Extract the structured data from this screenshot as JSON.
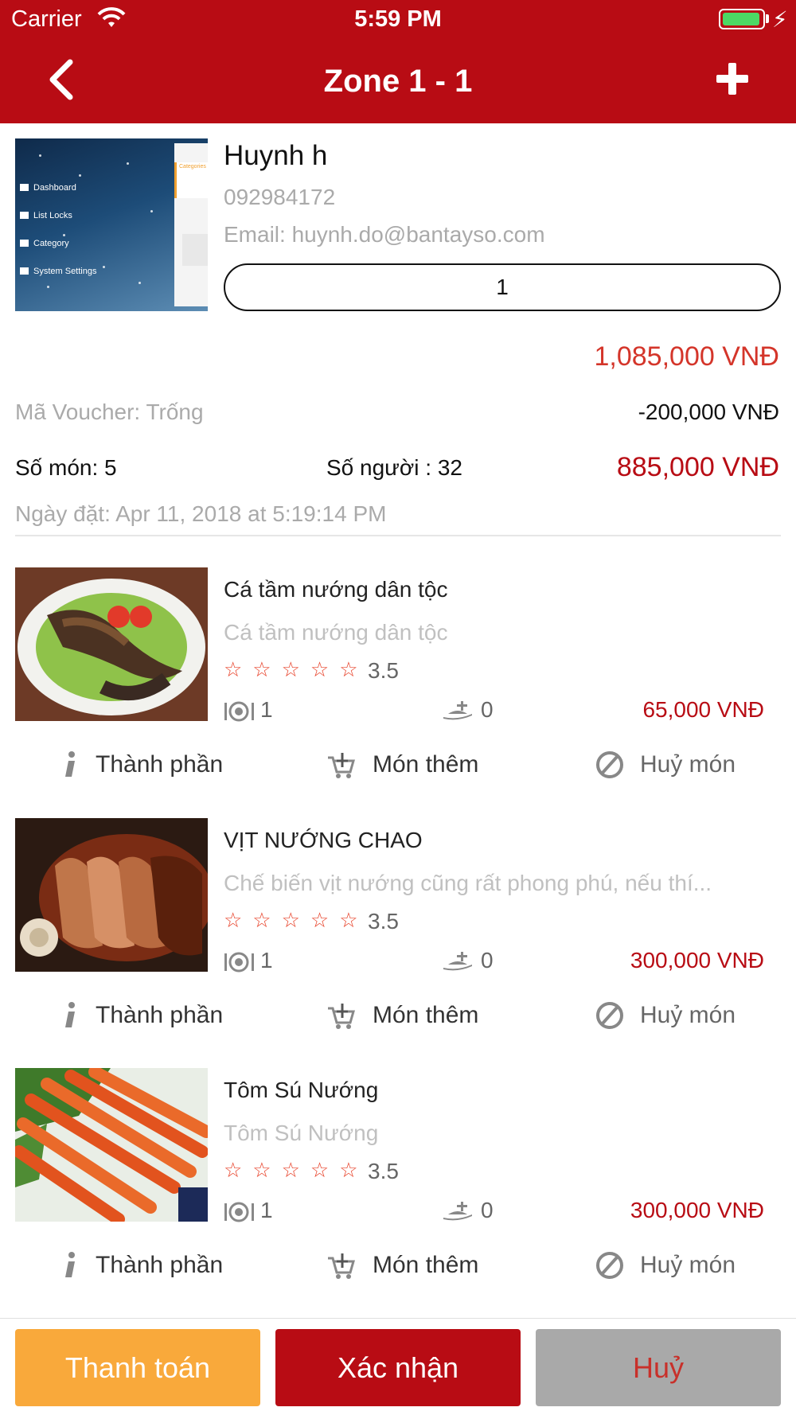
{
  "status_bar": {
    "carrier": "Carrier",
    "time": "5:59 PM"
  },
  "nav": {
    "title": "Zone 1 - 1",
    "back_icon": "chevron-left-icon",
    "add_icon": "plus-icon"
  },
  "customer": {
    "name": "Huynh h",
    "phone": "092984172",
    "email": "Email: huynh.do@bantayso.com",
    "table_number": "1",
    "thumbnail_menu": [
      "Dashboard",
      "List Locks",
      "Category",
      "System Settings"
    ],
    "thumbnail_panel_title": "Categories"
  },
  "summary": {
    "subtotal": "1,085,000 VNĐ",
    "voucher_label": "Mã Voucher: Trống",
    "voucher_amount": "-200,000 VNĐ",
    "dish_count": "Số món: 5",
    "people_count": "Số người : 32",
    "total": "885,000 VNĐ",
    "order_date": "Ngày đặt: Apr 11, 2018 at 5:19:14 PM"
  },
  "dishes": [
    {
      "name": "Cá tầm nướng dân tộc",
      "description": "Cá tầm nướng dân tộc",
      "stars": "☆☆☆☆☆",
      "rating": "3.5",
      "quantity": "1",
      "extras": "0",
      "price": "65,000 VNĐ"
    },
    {
      "name": "VỊT NƯỚNG CHAO",
      "description": "Chế biến vịt nướng cũng rất phong phú, nếu thí...",
      "stars": "☆☆☆☆☆",
      "rating": "3.5",
      "quantity": "1",
      "extras": "0",
      "price": "300,000 VNĐ"
    },
    {
      "name": "Tôm Sú Nướng",
      "description": "Tôm Sú Nướng",
      "stars": "☆☆☆☆☆",
      "rating": "3.5",
      "quantity": "1",
      "extras": "0",
      "price": "300,000 VNĐ"
    }
  ],
  "dish_actions": {
    "ingredients": "Thành phần",
    "extras": "Món thêm",
    "cancel_dish": "Huỷ món"
  },
  "footer": {
    "pay": "Thanh toán",
    "confirm": "Xác nhận",
    "cancel": "Huỷ"
  },
  "colors": {
    "brand_red": "#b80c14",
    "pay_orange": "#f9a93b",
    "cancel_gray": "#a9a9a9",
    "price_red": "#d4352a",
    "star_orange": "#e8442c"
  }
}
